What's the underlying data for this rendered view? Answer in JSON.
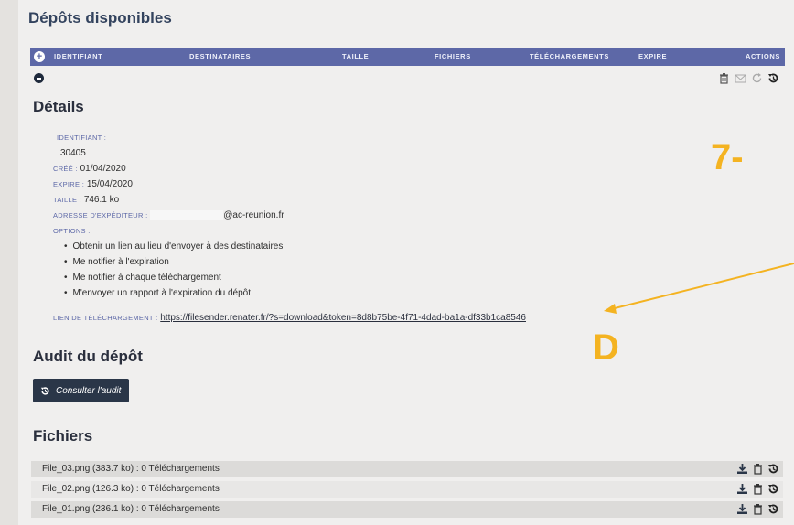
{
  "page_title": "Dépôts disponibles",
  "table_header": {
    "columns": [
      "Identifiant",
      "Destinataires",
      "Taille",
      "Fichiers",
      "Téléchargements",
      "Expire",
      "Actions"
    ]
  },
  "details": {
    "title": "Détails",
    "id_label": "Identifiant :",
    "id_value": "30405",
    "created_label": "Créé :",
    "created_value": "01/04/2020",
    "expires_label": "Expire :",
    "expires_value": "15/04/2020",
    "size_label": "Taille :",
    "size_value": "746.1 ko",
    "sender_label": "Adresse d'expéditeur :",
    "sender_value": "@ac-reunion.fr",
    "options_label": "Options :",
    "options": [
      "Obtenir un lien au lieu d'envoyer à des destinataires",
      "Me notifier à l'expiration",
      "Me notifier à chaque téléchargement",
      "M'envoyer un rapport à l'expiration du dépôt"
    ],
    "download_link_label": "Lien de téléchargement :",
    "download_link": "https://filesender.renater.fr/?s=download&token=8d8b75be-4f71-4dad-ba1a-df33b1ca8546"
  },
  "audit": {
    "title": "Audit du dépôt",
    "button_label": "Consulter l'audit"
  },
  "files": {
    "title": "Fichiers",
    "rows": [
      "File_03.png (383.7 ko) : 0 Téléchargements",
      "File_02.png (126.3 ko) : 0 Téléchargements",
      "File_01.png (236.1 ko) : 0 Téléchargements"
    ]
  },
  "annotations": {
    "step": "7-",
    "letter": "D"
  },
  "colors": {
    "header": "#5d68a7",
    "annotation": "#f4b321",
    "button": "#2a3648"
  }
}
